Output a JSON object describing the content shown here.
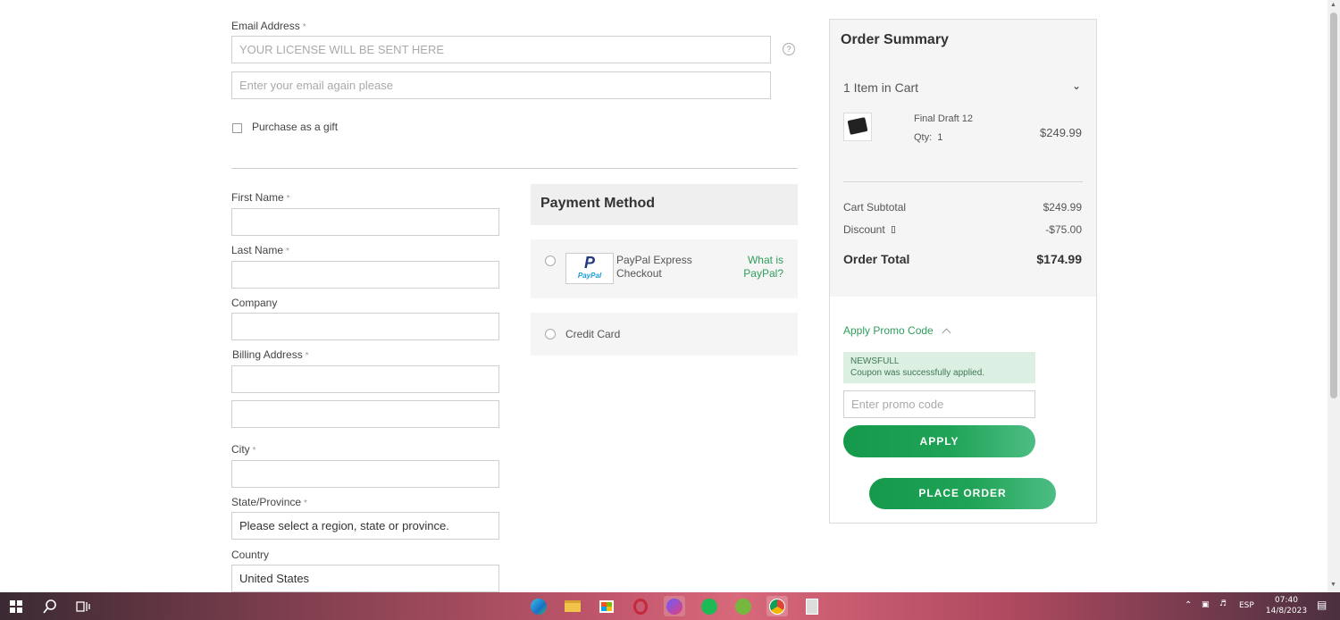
{
  "email": {
    "label": "Email Address",
    "req": "*",
    "placeholder1": "YOUR LICENSE WILL BE SENT HERE",
    "placeholder2": "Enter your email again please",
    "help_icon": "question-circle-icon"
  },
  "gift": {
    "label": "Purchase as a gift"
  },
  "billing": {
    "first_name": "First Name",
    "last_name": "Last Name",
    "company": "Company",
    "address": "Billing Address",
    "city": "City",
    "state": "State/Province",
    "state_value": "Please select a region, state or province.",
    "country": "Country",
    "country_value": "United States",
    "req": "*"
  },
  "payment": {
    "title": "Payment Method",
    "paypal_logo_text": "PayPal",
    "paypal_label_line1": "PayPal Express",
    "paypal_label_line2": "Checkout",
    "paypal_help_line1": "What is",
    "paypal_help_line2": "PayPal?",
    "credit_card": "Credit Card"
  },
  "summary": {
    "title": "Order Summary",
    "items_in_cart": "1 Item in Cart",
    "product_name": "Final Draft 12",
    "qty_label": "Qty:",
    "qty_value": "1",
    "product_price": "$249.99",
    "subtotal_label": "Cart Subtotal",
    "subtotal_value": "$249.99",
    "discount_label": "Discount",
    "discount_value": "-$75.00",
    "total_label": "Order Total",
    "total_value": "$174.99",
    "promo_toggle": "Apply Promo Code",
    "promo_code_applied": "NEWSFULL",
    "promo_message": "Coupon was successfully applied.",
    "promo_placeholder": "Enter promo code",
    "apply_button": "APPLY",
    "place_order_button": "PLACE ORDER"
  },
  "taskbar": {
    "lang": "ESP",
    "time": "07:40",
    "date": "14/8/2023"
  },
  "colors": {
    "accent_green": "#2e9e5b",
    "button_green": "#159a4c",
    "promo_bg": "#dcefe3"
  }
}
